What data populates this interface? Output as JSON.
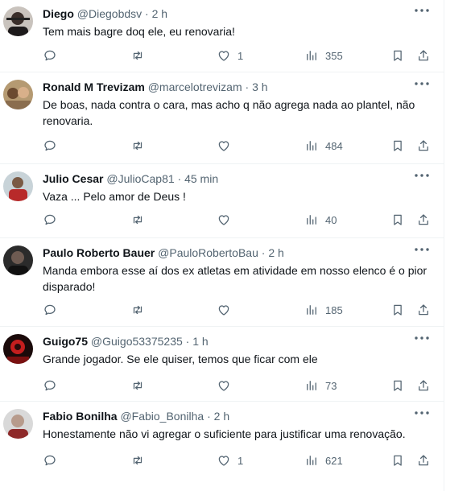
{
  "tweets": [
    {
      "name": "Diego",
      "handle": "@Diegobdsv",
      "dot": "·",
      "time": "2 h",
      "text": "Tem mais bagre doq ele, eu renovaria!",
      "likes": "1",
      "views": "355"
    },
    {
      "name": "Ronald M Trevizam",
      "handle": "@marcelotrevizam",
      "dot": "·",
      "time": "3 h",
      "text": "De boas,  nada contra o cara, mas acho q não agrega nada ao plantel, não renovaria.",
      "likes": "",
      "views": "484"
    },
    {
      "name": "Julio Cesar",
      "handle": "@JulioCap81",
      "dot": "·",
      "time": "45 min",
      "text": "Vaza ... Pelo amor de Deus !",
      "likes": "",
      "views": "40"
    },
    {
      "name": "Paulo Roberto Bauer",
      "handle": "@PauloRobertoBau",
      "dot": "·",
      "time": "2 h",
      "text": "Manda embora esse aí dos ex atletas em atividade em nosso elenco é o pior disparado!",
      "likes": "",
      "views": "185"
    },
    {
      "name": "Guigo75",
      "handle": "@Guigo53375235",
      "dot": "·",
      "time": "1 h",
      "text": "Grande jogador. Se ele quiser, temos que ficar com ele",
      "likes": "",
      "views": "73"
    },
    {
      "name": "Fabio Bonilha",
      "handle": "@Fabio_Bonilha",
      "dot": "·",
      "time": "2 h",
      "text": "Honestamente não vi agregar o suficiente para justificar uma renovação.",
      "likes": "1",
      "views": "621"
    }
  ],
  "icons": {
    "more": "more-icon",
    "reply": "reply-icon",
    "retweet": "retweet-icon",
    "like": "heart-icon",
    "views": "views-icon",
    "bookmark": "bookmark-icon",
    "share": "share-icon"
  },
  "colors": {
    "text": "#0f1419",
    "muted": "#536471",
    "divider": "#eff3f4"
  }
}
